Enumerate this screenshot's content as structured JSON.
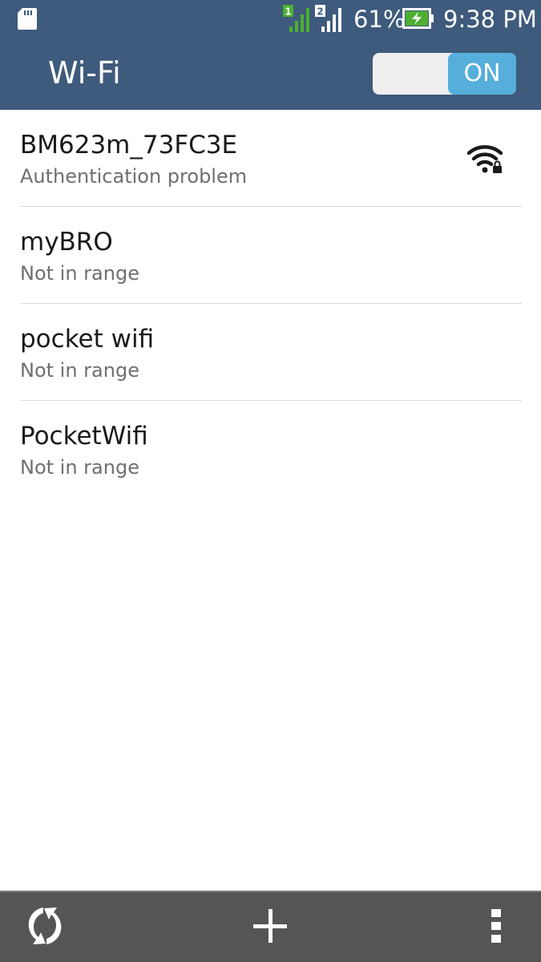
{
  "status_bar": {
    "sim1_label": "1",
    "sim2_label": "2",
    "battery_percent": "61%",
    "time": "9:38 PM",
    "icons": [
      "sd-card-icon",
      "signal-sim1-icon",
      "signal-sim2-icon",
      "battery-charging-icon"
    ],
    "colors": {
      "sim1": "#4caf32",
      "sim2": "#ffffff",
      "battery": "#4caf32"
    }
  },
  "header": {
    "title": "Wi-Fi",
    "toggle_label": "ON",
    "background": "#3e5a7c",
    "toggle_accent": "#56aedb"
  },
  "networks": [
    {
      "name": "BM623m_73FC3E",
      "status": "Authentication problem",
      "secured": true
    },
    {
      "name": "myBRO",
      "status": "Not in range"
    },
    {
      "name": "pocket wifi",
      "status": "Not in range"
    },
    {
      "name": "PocketWifi",
      "status": "Not in range"
    }
  ],
  "bottom_bar": {
    "icons": [
      "scan-icon",
      "plus-icon",
      "more-vert-icon"
    ],
    "background": "#555555"
  }
}
